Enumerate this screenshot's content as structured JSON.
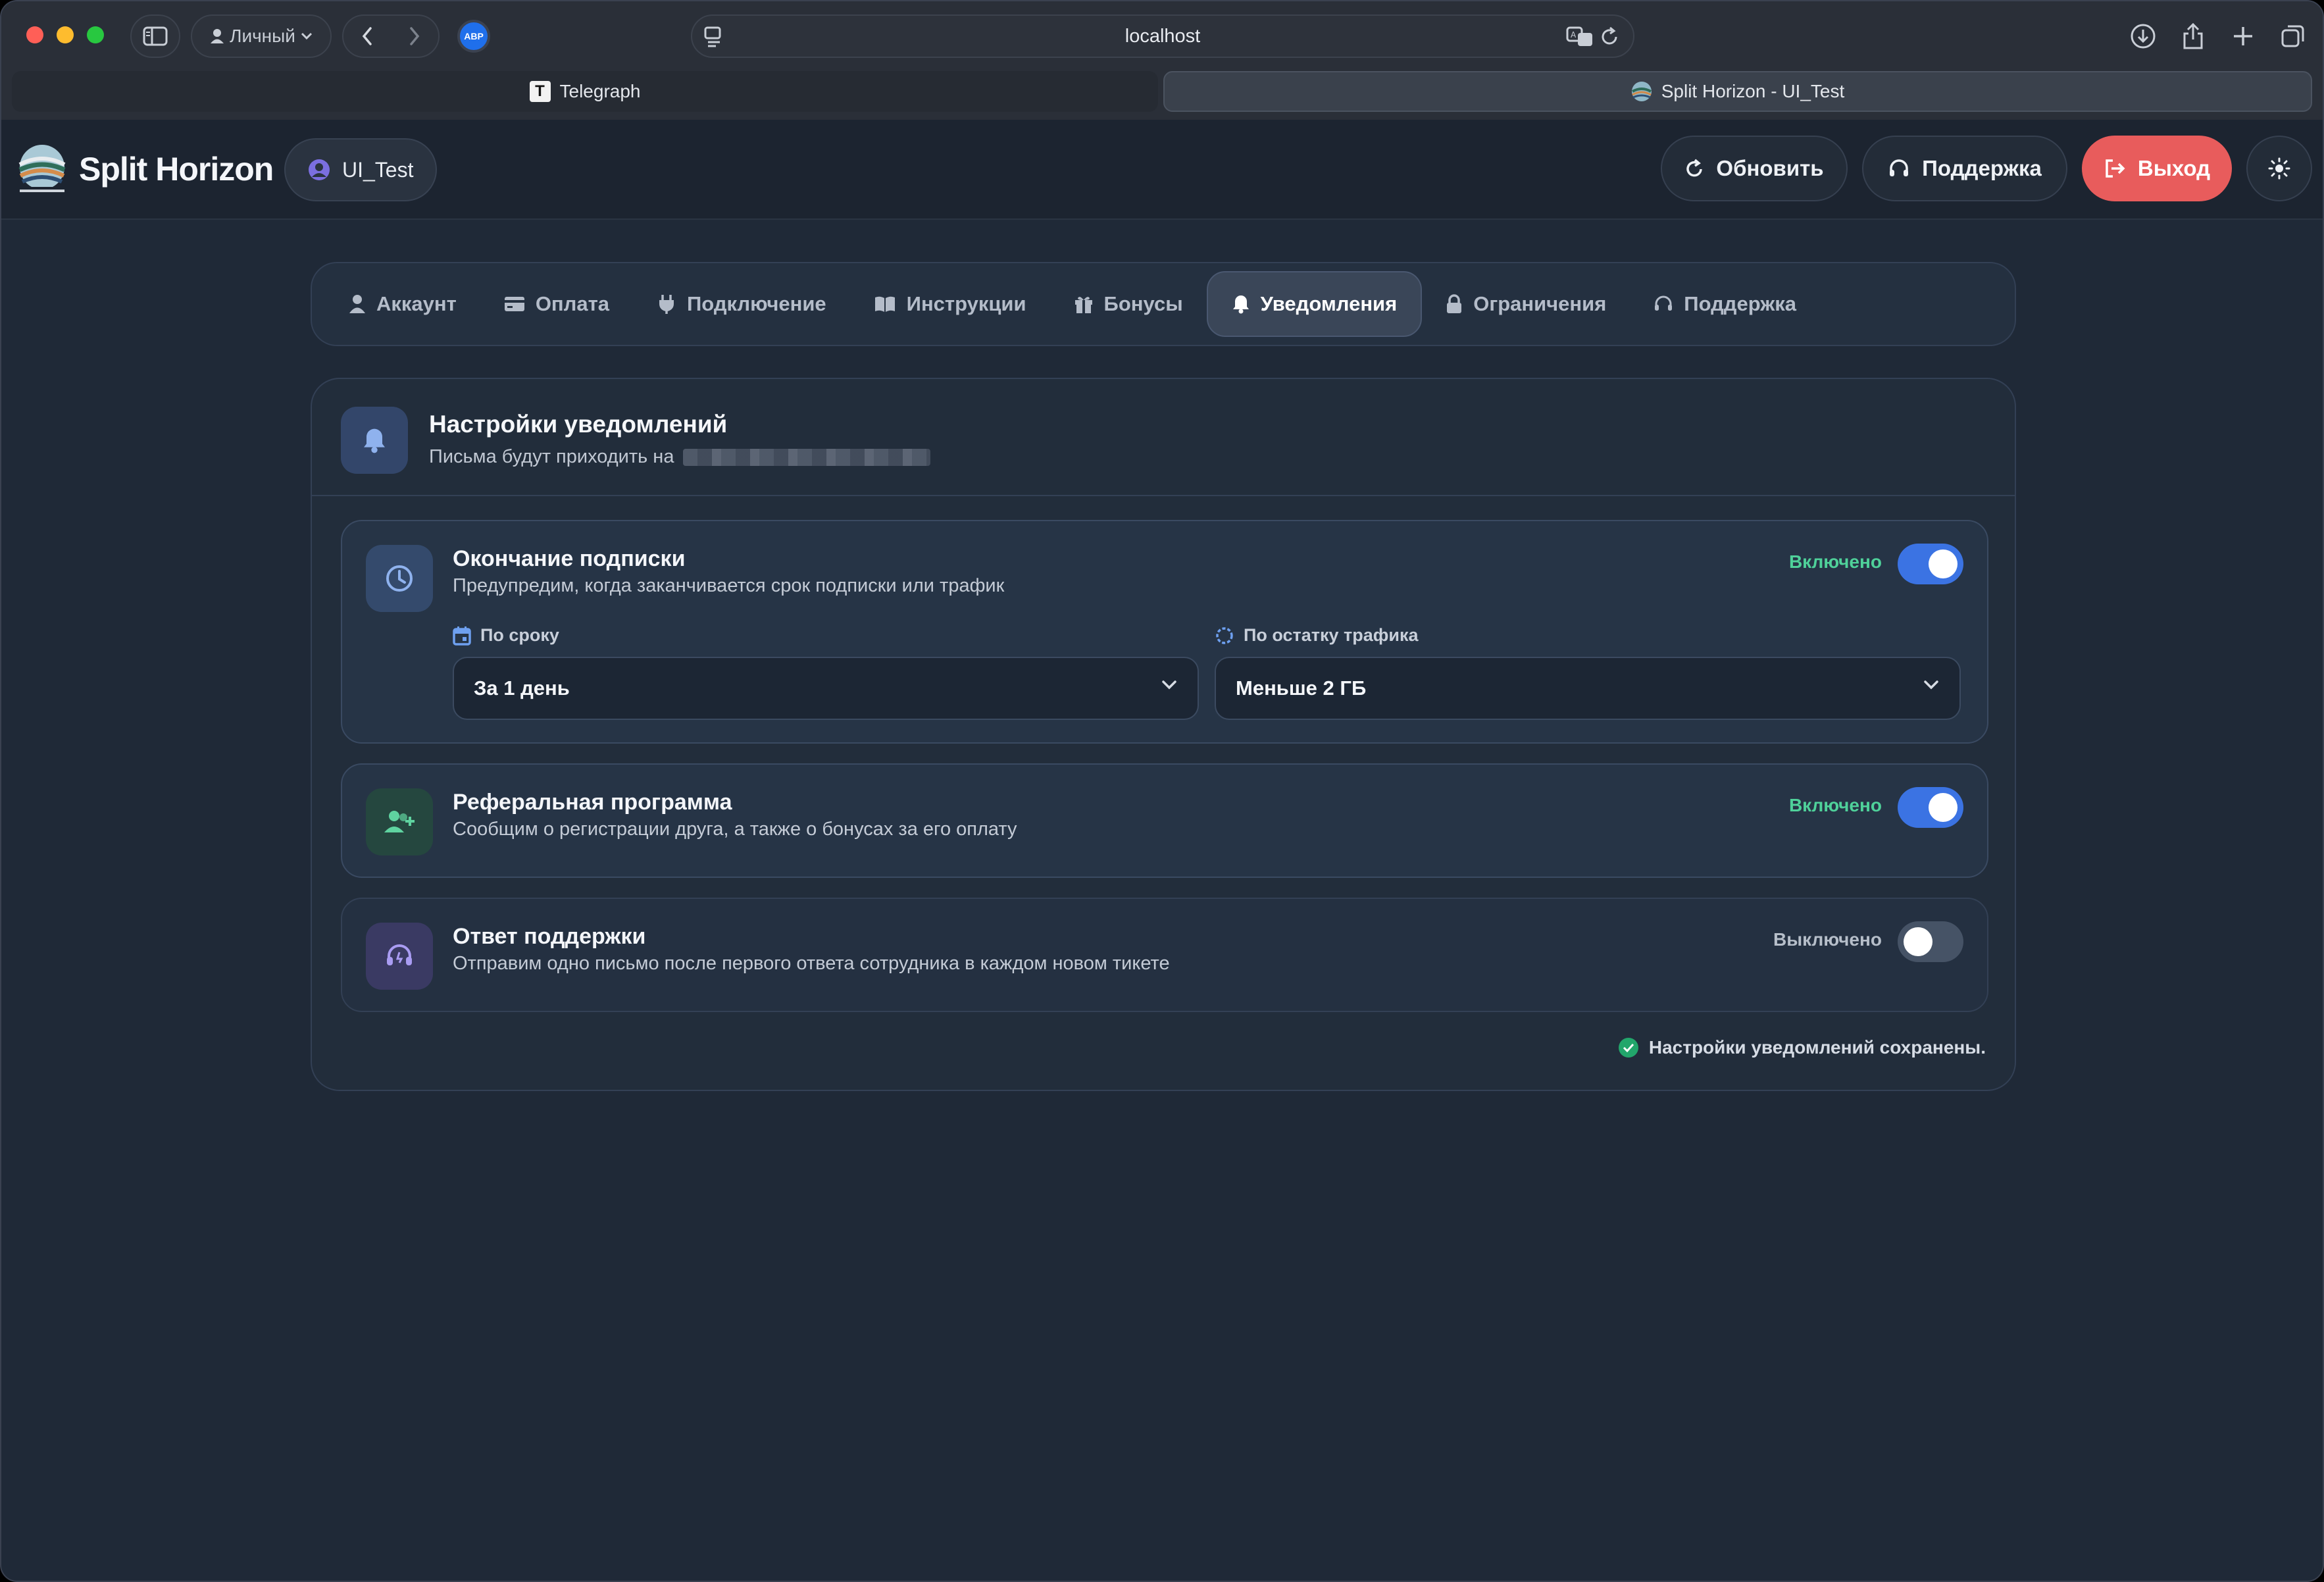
{
  "browser": {
    "profile_label": "Личный",
    "url": "localhost",
    "tabs": [
      {
        "label": "Telegraph",
        "favicon": "T"
      },
      {
        "label": "Split Horizon - UI_Test"
      }
    ]
  },
  "header": {
    "brand": "Split Horizon",
    "username": "UI_Test",
    "refresh_label": "Обновить",
    "support_label": "Поддержка",
    "logout_label": "Выход",
    "logout_color": "#e85c5c"
  },
  "nav": {
    "tabs": [
      {
        "label": "Аккаунт",
        "icon": "user-icon"
      },
      {
        "label": "Оплата",
        "icon": "credit-card-icon"
      },
      {
        "label": "Подключение",
        "icon": "plug-icon"
      },
      {
        "label": "Инструкции",
        "icon": "book-icon"
      },
      {
        "label": "Бонусы",
        "icon": "gift-icon"
      },
      {
        "label": "Уведомления",
        "icon": "bell-icon",
        "active": true
      },
      {
        "label": "Ограничения",
        "icon": "lock-icon"
      },
      {
        "label": "Поддержка",
        "icon": "headset-icon"
      }
    ]
  },
  "notifications": {
    "title": "Настройки уведомлений",
    "subtitle": "Письма будут приходить на",
    "items": [
      {
        "title": "Окончание подписки",
        "description": "Предупредим, когда заканчивается срок подписки или трафик",
        "status": "Включено",
        "enabled": true,
        "icon": "clock-icon",
        "by_term_label": "По сроку",
        "by_term_value": "За 1 день",
        "by_traffic_label": "По остатку трафика",
        "by_traffic_value": "Меньше 2 ГБ"
      },
      {
        "title": "Реферальная программа",
        "description": "Сообщим о регистрации друга, а также о бонусах за его оплату",
        "status": "Включено",
        "enabled": true,
        "icon": "user-plus-icon"
      },
      {
        "title": "Ответ поддержки",
        "description": "Отправим одно письмо после первого ответа сотрудника в каждом новом тикете",
        "status": "Выключено",
        "enabled": false,
        "icon": "headset-icon"
      }
    ],
    "saved_message": "Настройки уведомлений сохранены."
  },
  "colors": {
    "accent": "#3b73e3",
    "enabled_text": "#4fd19a",
    "background": "#1f2937"
  }
}
